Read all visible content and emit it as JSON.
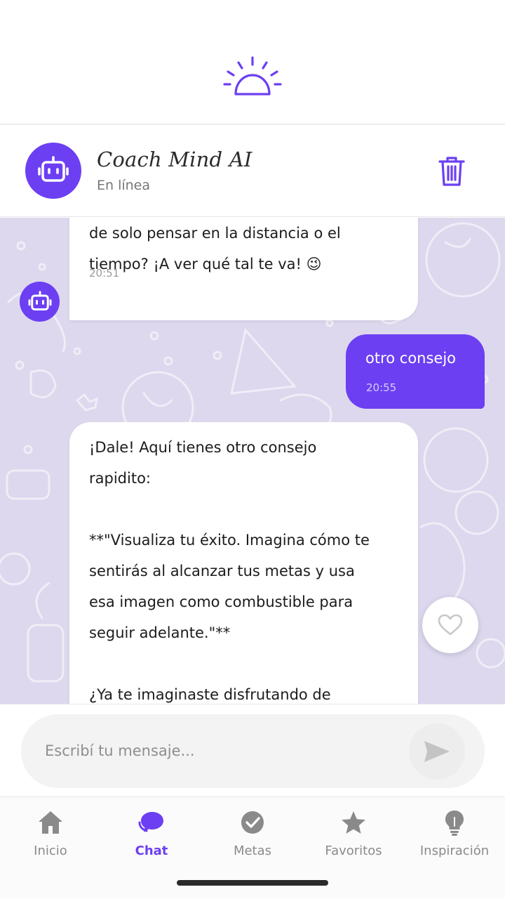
{
  "header": {
    "logo_icon": "sunrise-icon",
    "coach_name": "Coach Mind AI",
    "status": "En línea",
    "delete_icon": "trash-icon"
  },
  "messages": [
    {
      "sender": "coach",
      "text": "de solo pensar en la distancia o el\ntiempo? ¡A ver qué tal te va! 😉",
      "time": "20:51"
    },
    {
      "sender": "user",
      "text": "otro consejo",
      "time": "20:55"
    },
    {
      "sender": "coach",
      "text": "¡Dale! Aquí tienes otro consejo\nrapidito:\n\n**\"Visualiza tu éxito. Imagina cómo te\nsentirás al alcanzar tus metas y usa\nesa imagen como combustible para\nseguir adelante.\"**\n\n¿Ya te imaginaste disfrutando de"
    }
  ],
  "input": {
    "placeholder": "Escribí tu mensaje...",
    "value": ""
  },
  "nav": {
    "items": [
      {
        "label": "Inicio",
        "icon": "home-icon",
        "active": false
      },
      {
        "label": "Chat",
        "icon": "chat-icon",
        "active": true
      },
      {
        "label": "Metas",
        "icon": "check-circle-icon",
        "active": false
      },
      {
        "label": "Favoritos",
        "icon": "star-icon",
        "active": false
      },
      {
        "label": "Inspiración",
        "icon": "lightbulb-icon",
        "active": false
      }
    ]
  },
  "colors": {
    "accent": "#6c3ff2",
    "chat_background": "#ddd8ee",
    "inactive": "#8a8a8a"
  }
}
